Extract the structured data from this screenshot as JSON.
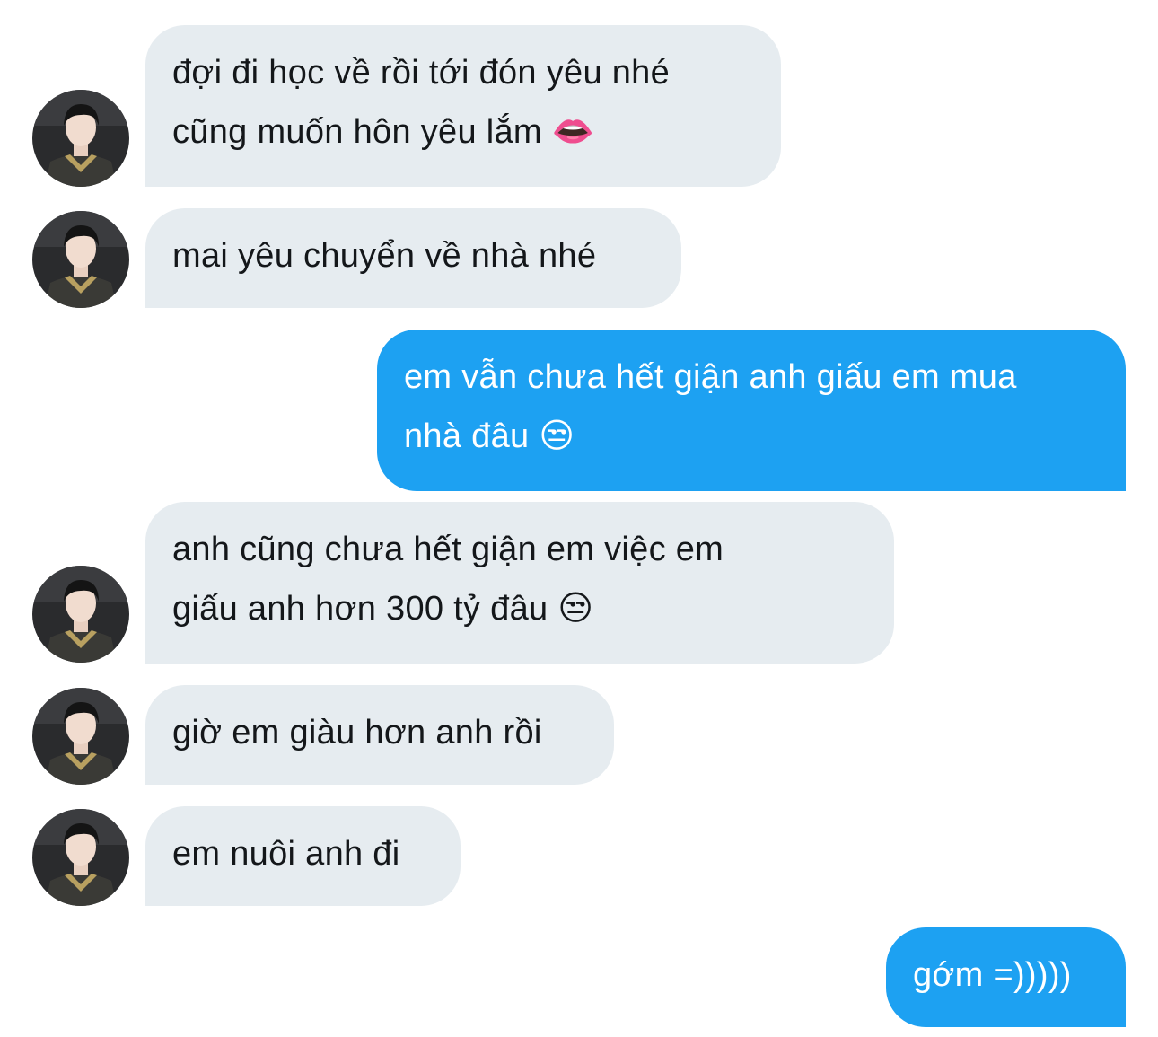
{
  "conversation": {
    "messages": [
      {
        "sender": "other",
        "lines": [
          "đợi đi học về rồi tới đón yêu nhé",
          "cũng muốn hôn yêu lắm 👄"
        ]
      },
      {
        "sender": "other",
        "lines": [
          "mai yêu chuyển về nhà nhé"
        ]
      },
      {
        "sender": "me",
        "lines": [
          "em vẫn chưa hết giận anh giấu em mua",
          "nhà đâu 😒"
        ]
      },
      {
        "sender": "other",
        "lines": [
          "anh cũng chưa hết giận em việc em",
          "giấu anh hơn 300 tỷ đâu 😒"
        ]
      },
      {
        "sender": "other",
        "lines": [
          "giờ em giàu hơn anh rồi"
        ]
      },
      {
        "sender": "other",
        "lines": [
          "em nuôi anh đi"
        ]
      },
      {
        "sender": "me",
        "lines": [
          "gớm =)))))"
        ]
      }
    ]
  },
  "colors": {
    "incoming_bubble": "#e6ecf0",
    "incoming_text": "#14171a",
    "outgoing_bubble": "#1da1f2",
    "outgoing_text": "#ffffff"
  },
  "icons": {
    "avatar": "user-avatar"
  }
}
